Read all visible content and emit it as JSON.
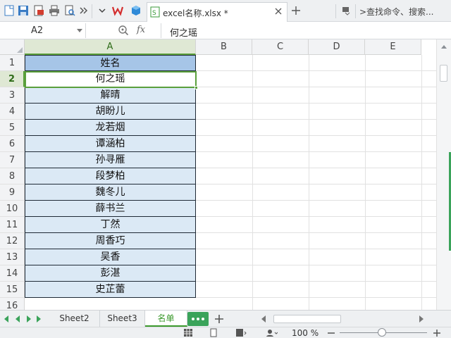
{
  "toolbar": {
    "file_tab_label": "excel名称.xlsx *",
    "search_label": ">查找命令、搜索..."
  },
  "formula_bar": {
    "name_box": "A2",
    "fx_label": "fx",
    "formula_value": "何之瑶"
  },
  "grid": {
    "columns": [
      "A",
      "B",
      "C",
      "D",
      "E"
    ],
    "active_column": "A",
    "rows": [
      "1",
      "2",
      "3",
      "4",
      "5",
      "6",
      "7",
      "8",
      "9",
      "10",
      "11",
      "12",
      "13",
      "14",
      "15",
      "16"
    ],
    "active_row": "2",
    "column_a": [
      "姓名",
      "何之瑶",
      "解晴",
      "胡盼儿",
      "龙若烟",
      "谭涵柏",
      "孙寻雁",
      "段梦柏",
      "魏冬儿",
      "薛书兰",
      "丁然",
      "周香巧",
      "吴香",
      "彭湛",
      "史芷蕾"
    ]
  },
  "sheets": {
    "tabs": [
      "Sheet2",
      "Sheet3",
      "名单"
    ],
    "active": "名单"
  },
  "status": {
    "zoom": "100 %",
    "zoom_level_percent": 100
  },
  "colors": {
    "accent": "#5aa03c",
    "header_fill": "#a6c5e7",
    "cell_fill": "#dbe9f5"
  }
}
